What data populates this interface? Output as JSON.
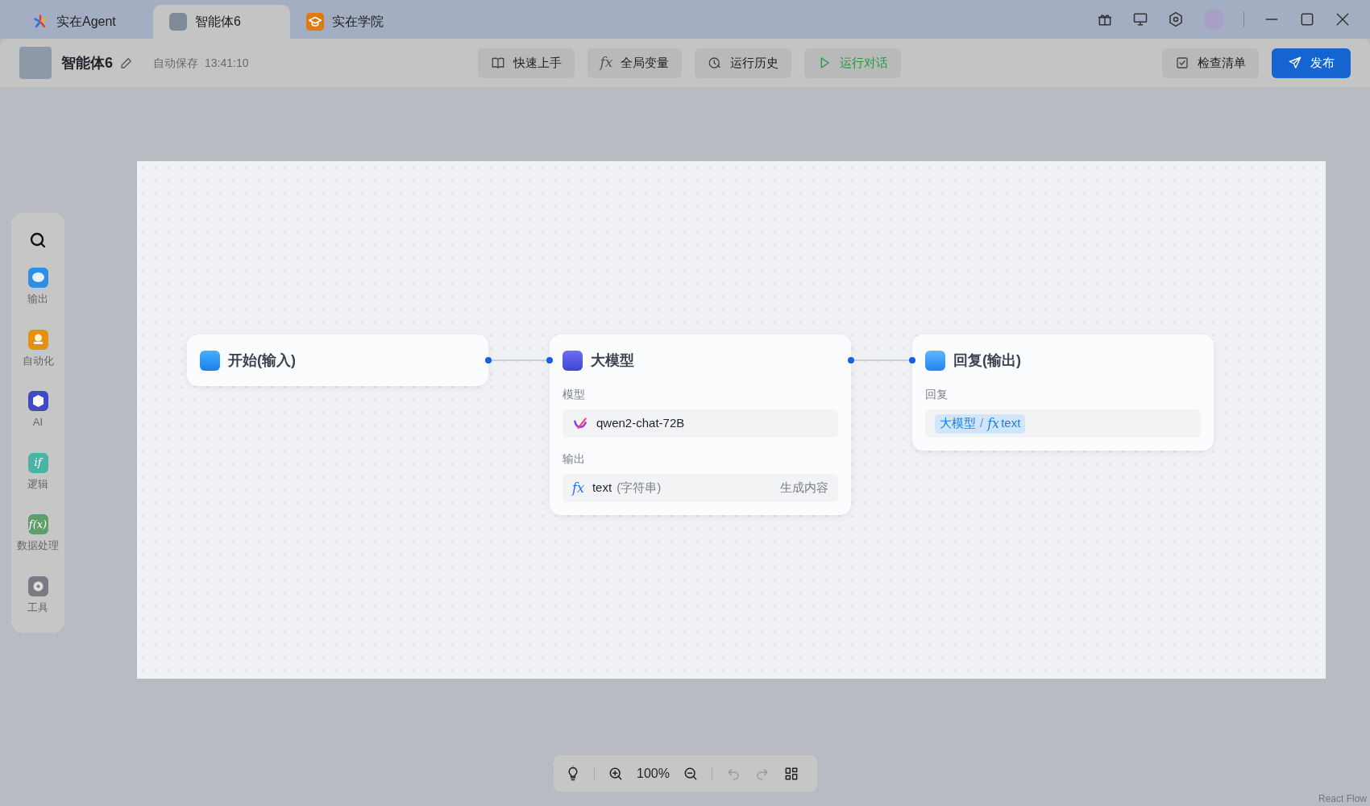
{
  "tabs": [
    {
      "label": "实在Agent",
      "selected": false,
      "kind": "logo"
    },
    {
      "label": "智能体6",
      "selected": true,
      "kind": "robot"
    },
    {
      "label": "实在学院",
      "selected": false,
      "kind": "academy"
    }
  ],
  "header": {
    "title": "智能体6",
    "autosave": "自动保存",
    "time": "13:41:10"
  },
  "toolbar": [
    {
      "label": "快速上手",
      "kind": "book"
    },
    {
      "label": "全局变量",
      "kind": "fx",
      "glyph": "fx"
    },
    {
      "label": "运行历史",
      "kind": "history"
    },
    {
      "label": "运行对话",
      "kind": "run"
    }
  ],
  "actions": [
    {
      "label": "检查清单",
      "kind": "checklist"
    },
    {
      "label": "发布",
      "kind": "publish"
    }
  ],
  "sidebar": [
    {
      "label": "输出",
      "kind": "output"
    },
    {
      "label": "自动化",
      "kind": "automation"
    },
    {
      "label": "AI",
      "kind": "ai"
    },
    {
      "label": "逻辑",
      "kind": "logic",
      "glyph": "if"
    },
    {
      "label": "数据处理",
      "kind": "data",
      "glyph": "f(x)"
    },
    {
      "label": "工具",
      "kind": "tool"
    }
  ],
  "nodes": [
    {
      "kind": "start",
      "title": "开始(输入)"
    },
    {
      "kind": "llm",
      "title": "大模型",
      "sections": [
        {
          "label": "模型",
          "kind": "model",
          "value": "qwen2-chat-72B"
        },
        {
          "label": "输出",
          "kind": "output",
          "glyph": "fx",
          "value": "text",
          "type": "(字符串)",
          "note": "生成内容"
        }
      ]
    },
    {
      "kind": "reply",
      "title": "回复(输出)",
      "sections": [
        {
          "label": "回复",
          "kind": "reference",
          "source": "大模型",
          "separator": "/",
          "glyph": "fx",
          "value": "text"
        }
      ]
    }
  ],
  "controls": {
    "zoom": "100%",
    "undo_disabled": true,
    "redo_disabled": true
  },
  "attribution": "React Flow"
}
